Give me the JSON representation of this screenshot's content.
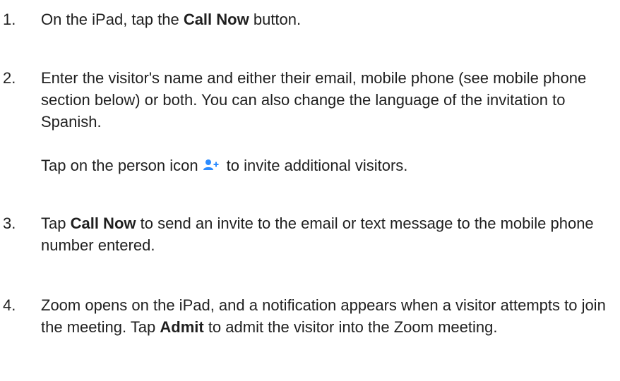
{
  "steps": [
    {
      "number": "1.",
      "parts": [
        "On the iPad, tap the ",
        "Call Now",
        " button."
      ]
    },
    {
      "number": "2.",
      "text": "Enter the visitor's name and either their email, mobile phone (see mobile phone section below) or both. You can also change the language of the invitation to Spanish.",
      "note_before": "Tap on the person icon",
      "note_icon": "add-person-icon",
      "note_after": "to invite additional visitors."
    },
    {
      "number": "3.",
      "parts": [
        "Tap ",
        "Call Now",
        " to send an invite to the email or text message to the mobile phone number entered."
      ]
    },
    {
      "number": "4.",
      "parts": [
        "Zoom opens on the iPad, and a notification appears when a visitor attempts to join the meeting. Tap ",
        "Admit",
        " to admit the visitor into the Zoom meeting."
      ]
    }
  ],
  "colors": {
    "text": "#1f1f1f",
    "icon": "#2d8cff"
  }
}
